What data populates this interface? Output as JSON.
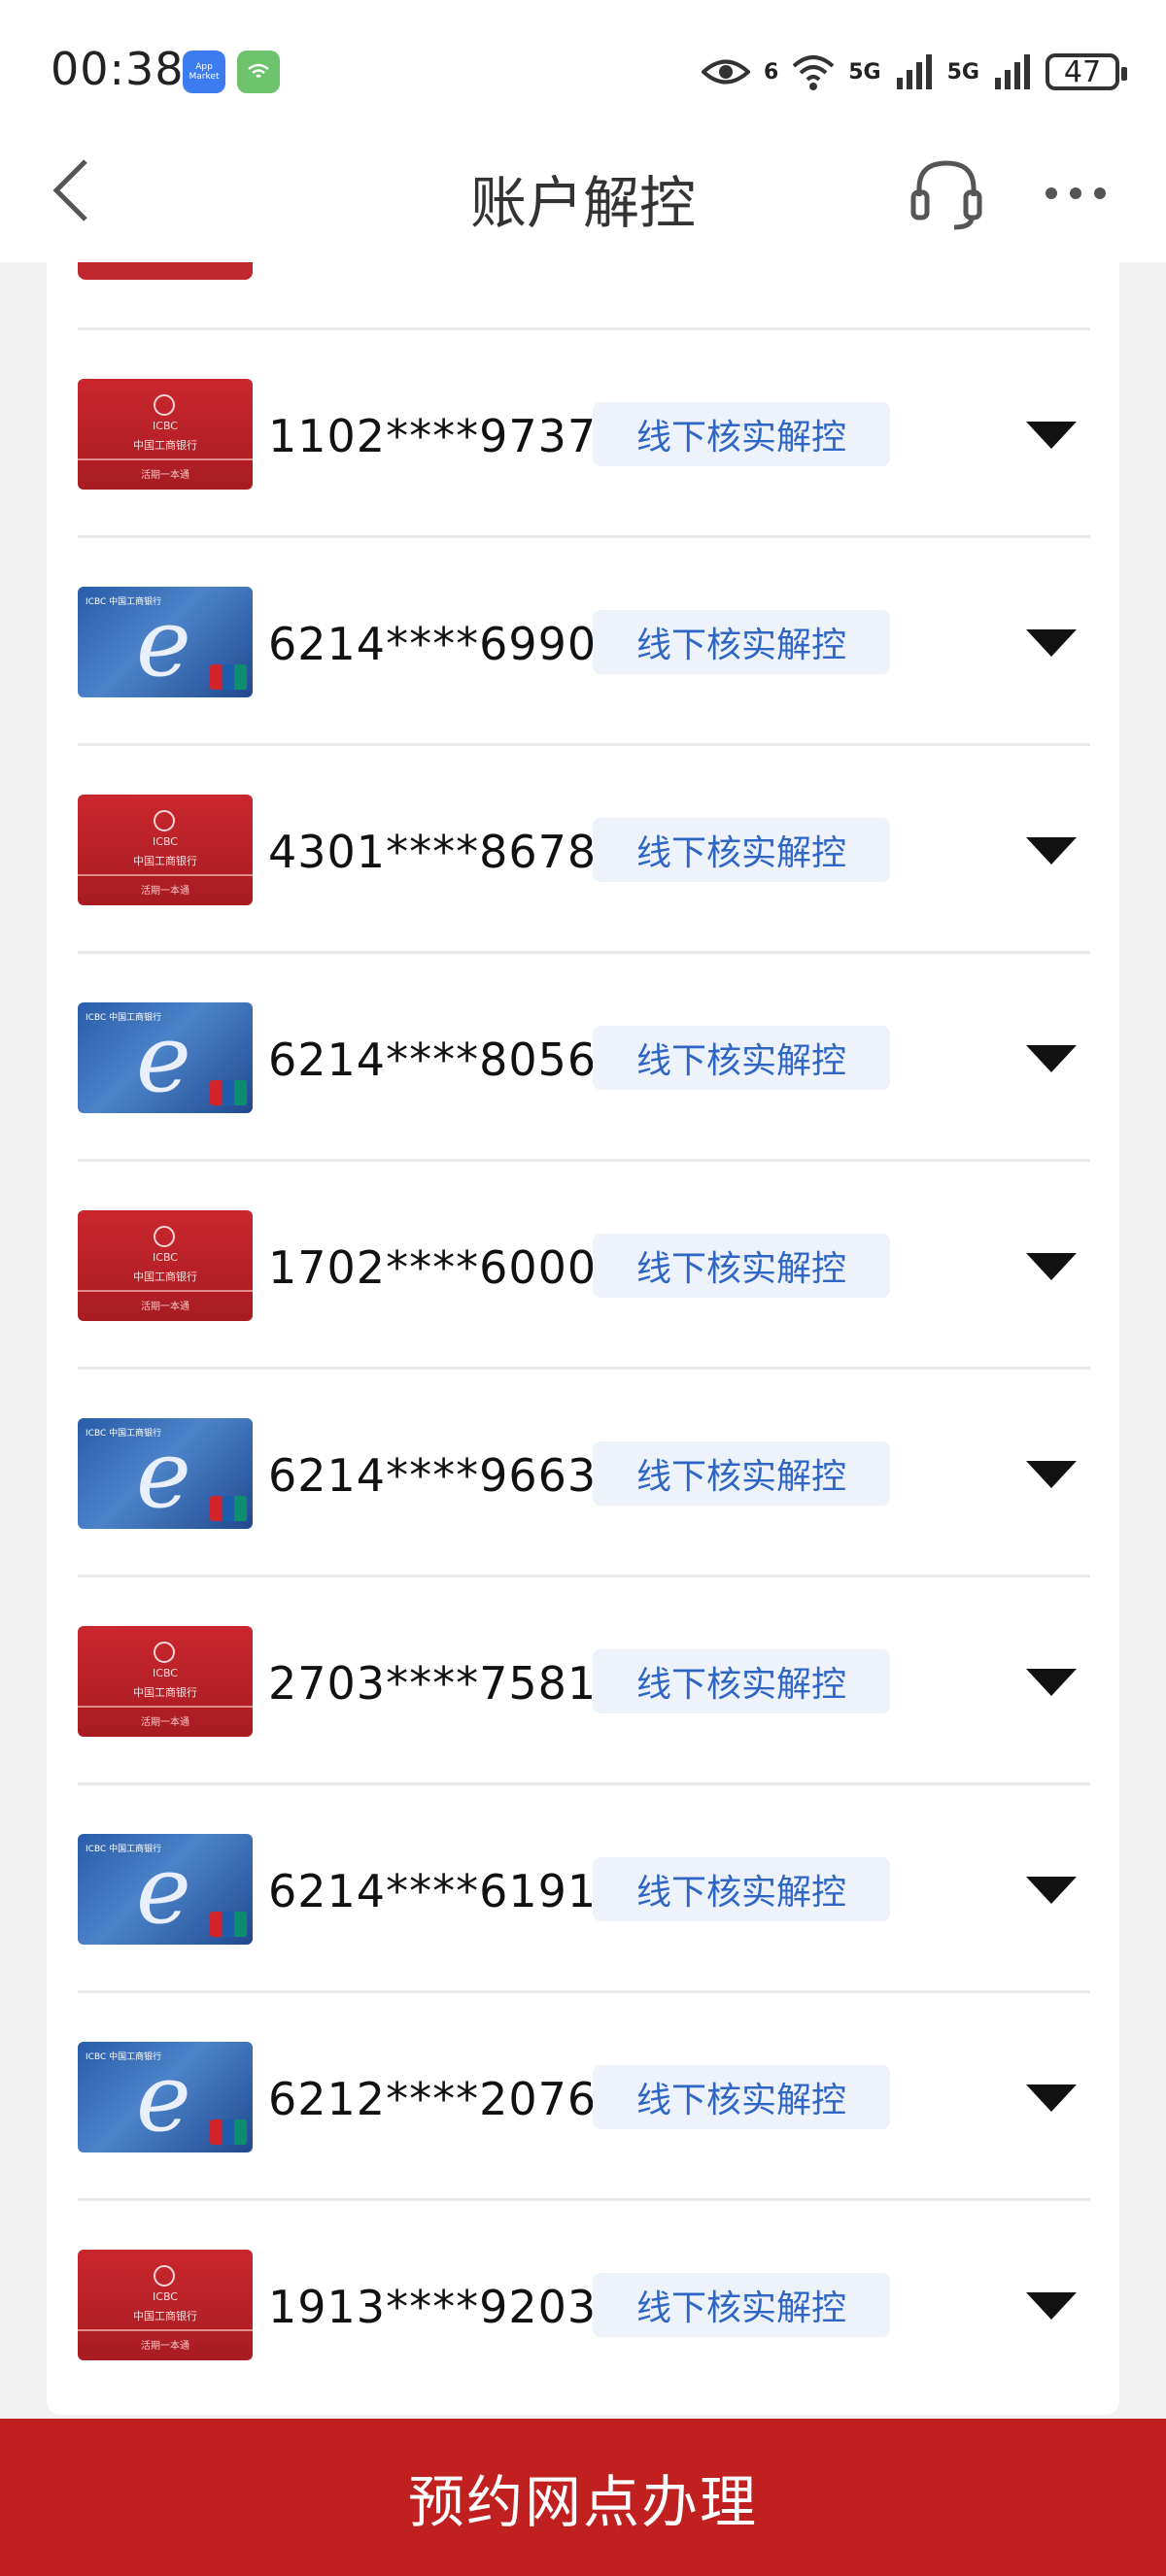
{
  "status_bar": {
    "time": "00:38",
    "app_badge_label": "App Market",
    "network_labels": [
      "6",
      "5G",
      "5G"
    ],
    "battery": "47"
  },
  "header": {
    "title": "账户解控",
    "back_icon": "chevron-left-icon",
    "support_icon": "headset-icon",
    "more_icon": "more-horizontal-icon"
  },
  "accounts": [
    {
      "number": "1102****9737",
      "status": "线下核实解控",
      "card_style": "red",
      "card_lines": [
        "ICBC",
        "中国工商银行",
        "活期一本通"
      ]
    },
    {
      "number": "6214****6990",
      "status": "线下核实解控",
      "card_style": "blue",
      "card_lines": [
        "ICBC 中国工商银行"
      ]
    },
    {
      "number": "4301****8678",
      "status": "线下核实解控",
      "card_style": "red",
      "card_lines": [
        "ICBC",
        "中国工商银行",
        "活期一本通"
      ]
    },
    {
      "number": "6214****8056",
      "status": "线下核实解控",
      "card_style": "blue",
      "card_lines": [
        "ICBC 中国工商银行"
      ]
    },
    {
      "number": "1702****6000",
      "status": "线下核实解控",
      "card_style": "red",
      "card_lines": [
        "ICBC",
        "中国工商银行",
        "活期一本通"
      ]
    },
    {
      "number": "6214****9663",
      "status": "线下核实解控",
      "card_style": "blue",
      "card_lines": [
        "ICBC 中国工商银行"
      ]
    },
    {
      "number": "2703****7581",
      "status": "线下核实解控",
      "card_style": "red",
      "card_lines": [
        "ICBC",
        "中国工商银行",
        "活期一本通"
      ]
    },
    {
      "number": "6214****6191",
      "status": "线下核实解控",
      "card_style": "blue",
      "card_lines": [
        "ICBC 中国工商银行"
      ]
    },
    {
      "number": "6212****2076",
      "status": "线下核实解控",
      "card_style": "blue",
      "card_lines": [
        "ICBC 中国工商银行"
      ]
    },
    {
      "number": "1913****9203",
      "status": "线下核实解控",
      "card_style": "red",
      "card_lines": [
        "ICBC",
        "中国工商银行",
        "活期一本通"
      ]
    }
  ],
  "bottom_button": {
    "label": "预约网点办理"
  },
  "colors": {
    "brand_red": "#c0201f",
    "tag_text_blue": "#2f66c6",
    "tag_bg": "#eef3fb"
  }
}
